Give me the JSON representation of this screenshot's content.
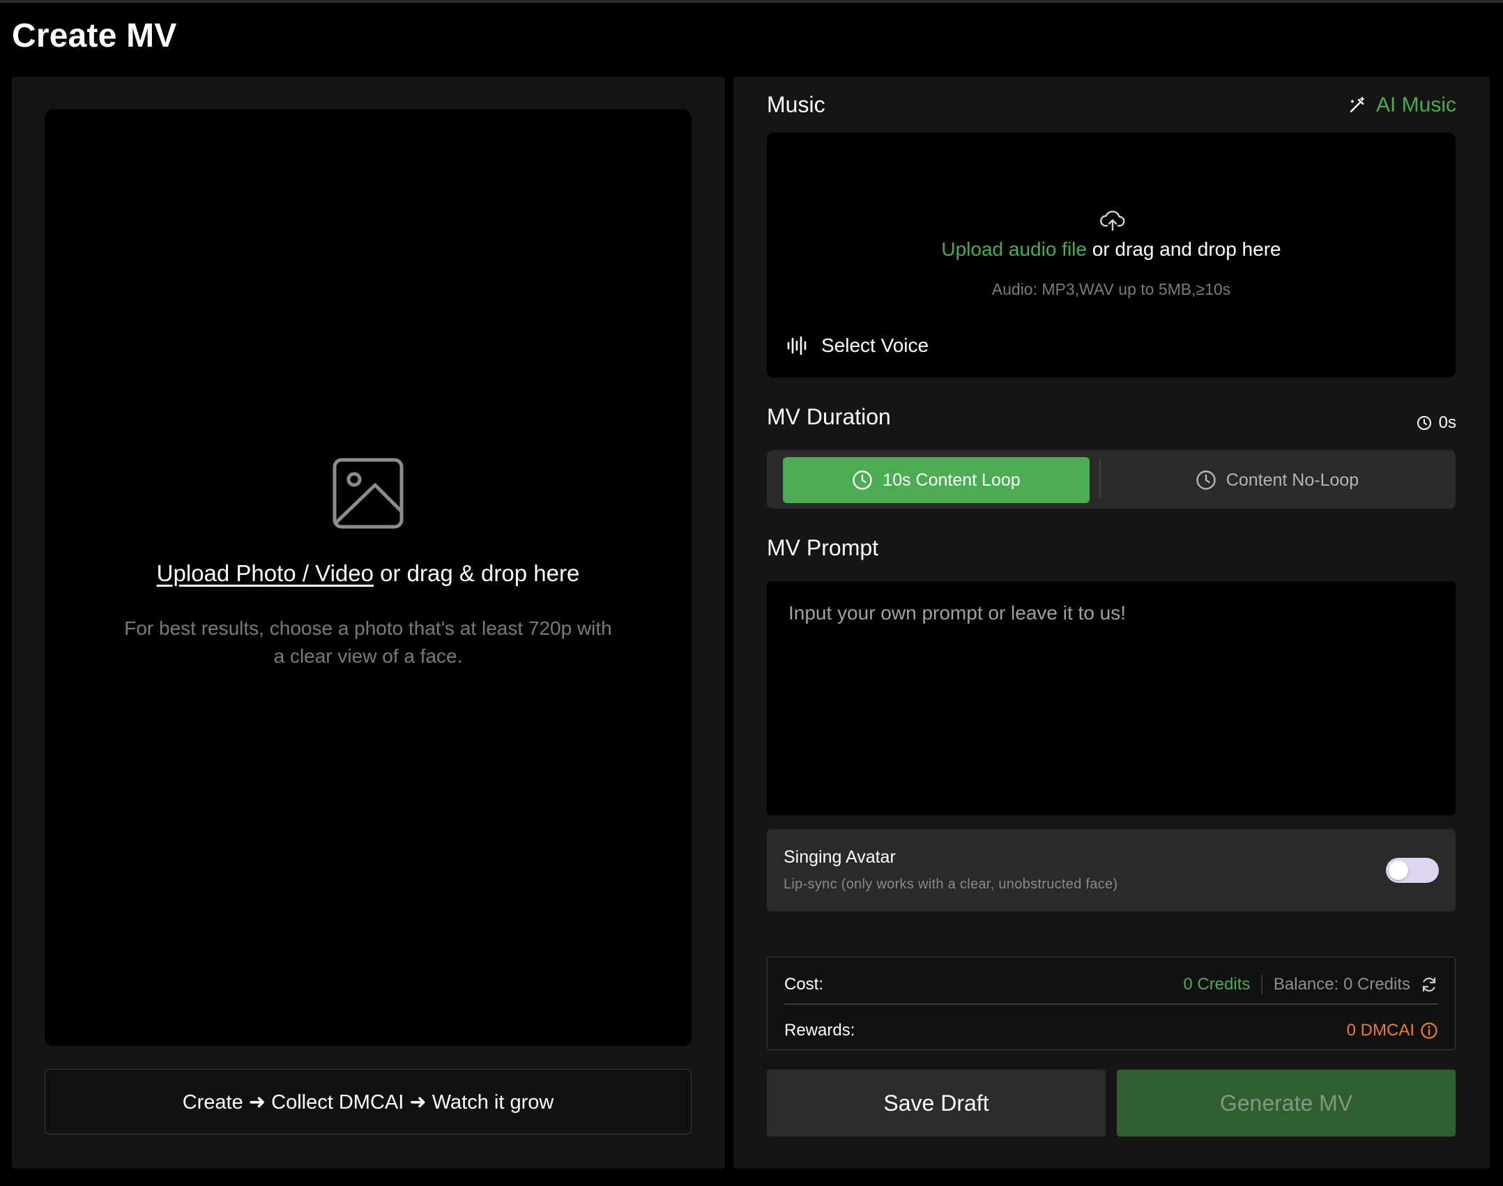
{
  "page": {
    "title": "Create MV"
  },
  "left": {
    "upload_link": "Upload Photo / Video",
    "upload_rest": " or drag & drop here",
    "hint": "For best results, choose a photo that's at least 720p with a clear view of a face.",
    "tagline": "Create ➜ Collect DMCAI ➜ Watch it grow",
    "icons": {
      "photo": "image-icon"
    }
  },
  "music": {
    "title": "Music",
    "ai_music_label": "AI Music",
    "upload_link": "Upload audio file",
    "upload_rest": " or drag and drop here",
    "hint": "Audio: MP3,WAV up to 5MB,≥10s",
    "select_voice": "Select Voice",
    "icons": {
      "ai": "magic-wand-icon",
      "upload": "cloud-upload-icon",
      "voice": "waveform-icon"
    }
  },
  "duration": {
    "title": "MV Duration",
    "readout": "0s",
    "options": [
      {
        "label": "10s Content Loop",
        "selected": true
      },
      {
        "label": "Content No-Loop",
        "selected": false
      }
    ]
  },
  "prompt": {
    "title": "MV Prompt",
    "placeholder": "Input your own prompt or leave it to us!",
    "value": ""
  },
  "singing_avatar": {
    "title": "Singing Avatar",
    "subtitle": "Lip-sync (only works with a clear, unobstructed face)",
    "enabled": false
  },
  "cost": {
    "cost_label": "Cost:",
    "cost_value": "0 Credits",
    "balance": "Balance: 0 Credits",
    "rewards_label": "Rewards:",
    "rewards_value": "0 DMCAI"
  },
  "actions": {
    "save_draft": "Save Draft",
    "generate": "Generate MV"
  },
  "colors": {
    "accent_green": "#4aad52",
    "reward_orange": "#ef7a30",
    "generate_disabled": "#2f5e30"
  }
}
